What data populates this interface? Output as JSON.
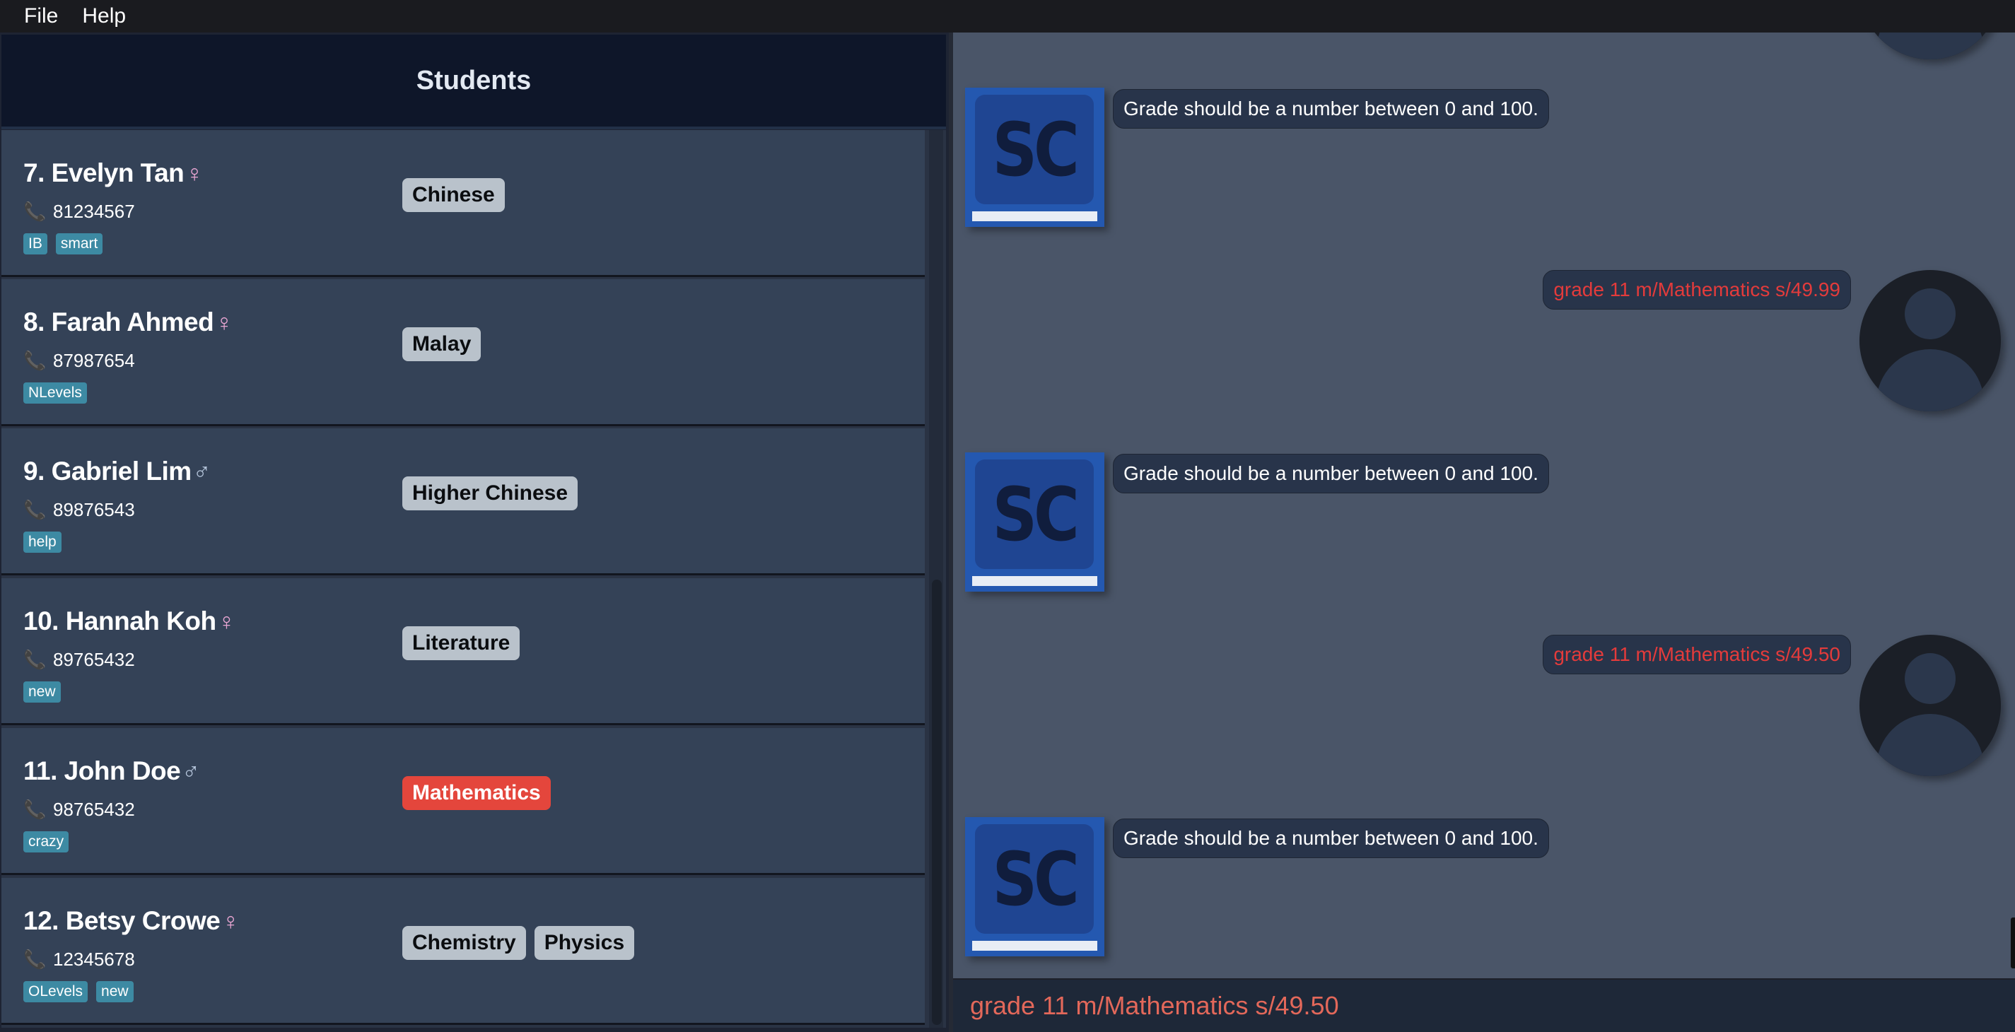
{
  "menu": {
    "file": "File",
    "help": "Help"
  },
  "student_panel": {
    "title": "Students",
    "students": [
      {
        "name": "7. Evelyn Tan",
        "gender": "♀",
        "phone": "81234567",
        "tags": [
          "IB",
          "smart"
        ],
        "subjects": [
          "Chinese"
        ]
      },
      {
        "name": "8. Farah Ahmed",
        "gender": "♀",
        "phone": "87987654",
        "tags": [
          "NLevels"
        ],
        "subjects": [
          "Malay"
        ]
      },
      {
        "name": "9. Gabriel Lim",
        "gender": "♂",
        "phone": "89876543",
        "tags": [
          "help"
        ],
        "subjects": [
          "Higher Chinese"
        ]
      },
      {
        "name": "10. Hannah Koh",
        "gender": "♀",
        "phone": "89765432",
        "tags": [
          "new"
        ],
        "subjects": [
          "Literature"
        ]
      },
      {
        "name": "11. John Doe",
        "gender": "♂",
        "phone": "98765432",
        "tags": [
          "crazy"
        ],
        "subjects": [
          "Mathematics"
        ]
      },
      {
        "name": "12. Betsy Crowe",
        "gender": "♀",
        "phone": "12345678",
        "tags": [
          "OLevels",
          "new"
        ],
        "subjects": [
          "Chemistry",
          "Physics"
        ]
      }
    ],
    "highlighted_subject": "Mathematics"
  },
  "chat": {
    "bot_avatar_text": "SC",
    "messages": [
      {
        "sender": "bot",
        "text": "Grade should be a number between 0 and 100."
      },
      {
        "sender": "user",
        "text": "grade 11 m/Mathematics s/49.99"
      },
      {
        "sender": "bot",
        "text": "Grade should be a number between 0 and 100."
      },
      {
        "sender": "user",
        "text": "grade 11 m/Mathematics s/49.50"
      },
      {
        "sender": "bot",
        "text": "Grade should be a number between 0 and 100."
      }
    ]
  },
  "command_box": {
    "value": "grade 11 m/Mathematics s/49.50"
  },
  "colors": {
    "menu_bar": "#1a1b1f",
    "header": "#0e1629",
    "student_card": "#344257",
    "tag": "#3d8aa3",
    "subject": "#b9c2cb",
    "subject_highlight": "#e4463c",
    "chat_background": "#4a5568",
    "user_text": "#e43b3b",
    "command_text": "#e3685a"
  },
  "icons": {
    "phone": "phone-icon",
    "bot": "sc-logo-icon",
    "user": "user-avatar-icon"
  }
}
